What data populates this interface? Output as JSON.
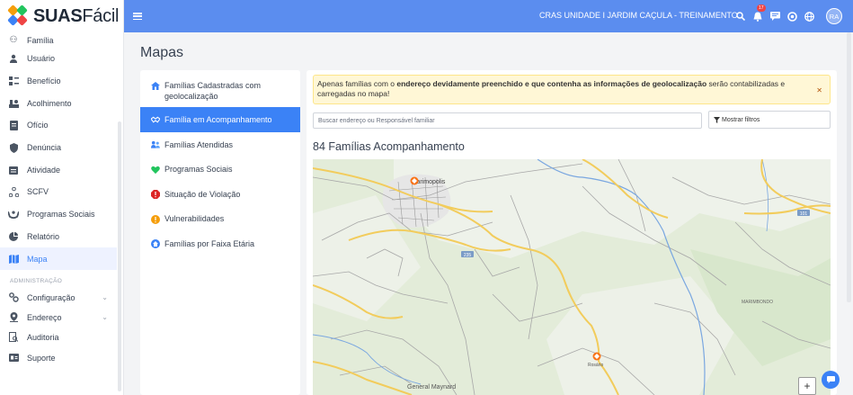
{
  "brand": {
    "name_bold": "SUAS",
    "name_regular": "Fácil"
  },
  "sidebar": {
    "items": [
      {
        "label": "Família",
        "icon": "family-icon"
      },
      {
        "label": "Usuário",
        "icon": "user-icon"
      },
      {
        "label": "Benefício",
        "icon": "benefit-icon"
      },
      {
        "label": "Acolhimento",
        "icon": "reception-icon"
      },
      {
        "label": "Ofício",
        "icon": "document-icon"
      },
      {
        "label": "Denúncia",
        "icon": "shield-icon"
      },
      {
        "label": "Atividade",
        "icon": "calendar-icon"
      },
      {
        "label": "SCFV",
        "icon": "network-icon"
      },
      {
        "label": "Programas Sociais",
        "icon": "hands-icon"
      },
      {
        "label": "Relatório",
        "icon": "chart-icon"
      },
      {
        "label": "Mapa",
        "icon": "map-icon",
        "active": true
      }
    ],
    "section_admin": "ADMINISTRAÇÃO",
    "admin_items": [
      {
        "label": "Configuração",
        "icon": "gears-icon"
      },
      {
        "label": "Endereço",
        "icon": "location-icon"
      },
      {
        "label": "Auditoria",
        "icon": "audit-icon"
      },
      {
        "label": "Suporte",
        "icon": "support-icon"
      }
    ]
  },
  "header": {
    "unit": "CRAS UNIDADE I JARDIM CAÇULA - TREINAMENTO",
    "notification_count": "17",
    "avatar_initials": "RA"
  },
  "page": {
    "title": "Mapas"
  },
  "map_menu": {
    "items": [
      {
        "label": "Famílias Cadastradas com geolocalização",
        "icon": "house-icon",
        "color": "#3b82f6"
      },
      {
        "label": "Família em Acompanhamento",
        "icon": "handshake-icon",
        "color": "#ffffff",
        "active": true
      },
      {
        "label": "Famílias Atendidas",
        "icon": "people-icon",
        "color": "#3b82f6"
      },
      {
        "label": "Programas Sociais",
        "icon": "heart-icon",
        "color": "#22c55e"
      },
      {
        "label": "Situação de Violação",
        "icon": "alert-icon",
        "color": "#dc2626"
      },
      {
        "label": "Vulnerabilidades",
        "icon": "warning-icon",
        "color": "#f59e0b"
      },
      {
        "label": "Famílias por Faixa Etária",
        "icon": "home-icon",
        "color": "#3b82f6"
      }
    ]
  },
  "alert": {
    "prefix": "Apenas famílias com o ",
    "bold": "endereço devidamente preenchido e que contenha as informações de geolocalização",
    "suffix": " serão contabilizadas e carregadas no mapa!"
  },
  "search": {
    "placeholder": "Buscar endereço ou Responsável familiar"
  },
  "filter": {
    "label": "Mostrar filtros"
  },
  "result": {
    "count_label": "84 Famílias Acompanhamento"
  },
  "map": {
    "labels": {
      "town1": "Jarimopolis",
      "town2": "General Maynard",
      "town3": "Rosário",
      "region": "MARIMBONDO",
      "road1": "235",
      "road2": "101"
    },
    "zoom_in": "+"
  }
}
